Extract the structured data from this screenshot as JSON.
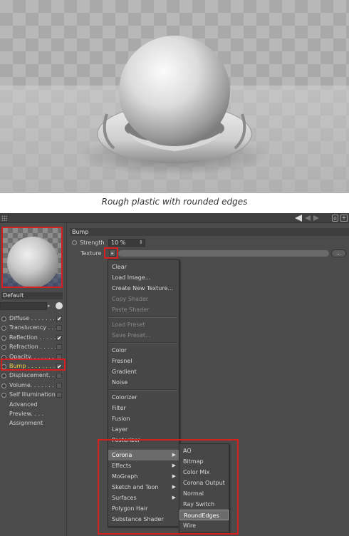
{
  "caption": "Rough plastic with rounded edges",
  "material": {
    "name": "Default"
  },
  "channels": [
    {
      "label": "Diffuse . . . . . . . .",
      "radio": true,
      "checked": "✔"
    },
    {
      "label": "Translucency . . .",
      "radio": true,
      "checked": ""
    },
    {
      "label": "Reflection . . . . .",
      "radio": true,
      "checked": "✔"
    },
    {
      "label": "Refraction . . . . .",
      "radio": true,
      "checked": ""
    },
    {
      "label": "Opacity. . . . . . . .",
      "radio": true,
      "checked": ""
    },
    {
      "label": "Bump . . . . . . . .",
      "radio": true,
      "checked": "✔",
      "active": true
    },
    {
      "label": "Displacement. . .",
      "radio": true,
      "checked": ""
    },
    {
      "label": "Volume. . . . . . .",
      "radio": true,
      "checked": ""
    },
    {
      "label": "Self Illumination",
      "radio": true,
      "checked": ""
    },
    {
      "label": "Advanced",
      "radio": false
    },
    {
      "label": "Preview. . . .",
      "radio": false
    },
    {
      "label": "Assignment",
      "radio": false
    }
  ],
  "group": {
    "title": "Bump",
    "strength_label": "Strength",
    "strength_value": "10 %",
    "texture_label": "Texture",
    "more_label": "..."
  },
  "menu_main": [
    {
      "label": "Clear"
    },
    {
      "label": "Load Image..."
    },
    {
      "label": "Create New Texture..."
    },
    {
      "label": "Copy Shader",
      "disabled": true
    },
    {
      "label": "Paste Shader",
      "disabled": true
    },
    {
      "sep": true
    },
    {
      "label": "Load Preset",
      "disabled": true
    },
    {
      "label": "Save Preset...",
      "disabled": true
    },
    {
      "sep": true
    },
    {
      "label": "Color"
    },
    {
      "label": "Fresnel"
    },
    {
      "label": "Gradient"
    },
    {
      "label": "Noise"
    },
    {
      "sep": true
    },
    {
      "label": "Colorizer"
    },
    {
      "label": "Filter"
    },
    {
      "label": "Fusion"
    },
    {
      "label": "Layer"
    },
    {
      "label": "Posterizer"
    },
    {
      "sep": true
    },
    {
      "label": "Corona",
      "submenu": true,
      "highlighted": true
    },
    {
      "label": "Effects",
      "submenu": true
    },
    {
      "label": "MoGraph",
      "submenu": true
    },
    {
      "label": "Sketch and Toon",
      "submenu": true
    },
    {
      "label": "Surfaces",
      "submenu": true
    },
    {
      "label": "Polygon Hair"
    },
    {
      "label": "Substance Shader"
    }
  ],
  "menu_corona": [
    {
      "label": "AO"
    },
    {
      "label": "Bitmap"
    },
    {
      "label": "Color Mix"
    },
    {
      "label": "Corona Output"
    },
    {
      "label": "Normal"
    },
    {
      "label": "Ray Switch"
    },
    {
      "label": "RoundEdges",
      "highlighted": true
    },
    {
      "label": "Wire"
    }
  ],
  "icons": {
    "submenu_arrow": "▶",
    "check": "✔",
    "spin": "⇕",
    "drop": "▸"
  }
}
